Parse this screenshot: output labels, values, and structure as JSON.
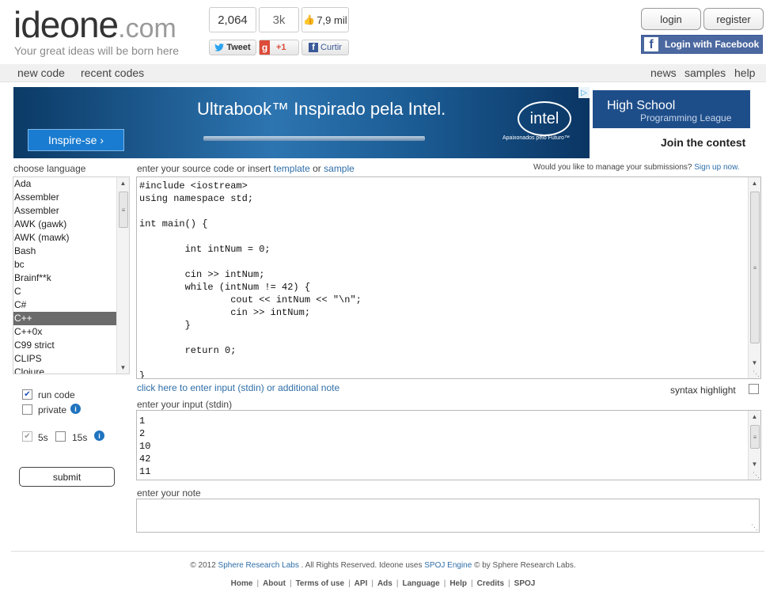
{
  "header": {
    "logo_main": "ideone",
    "logo_tld": ".com",
    "tagline": "Your great ideas will be born here",
    "tweet_count": "2,064",
    "gplus_count": "3k",
    "fb_count": "7,9 mil",
    "tweet_label": "Tweet",
    "gplus_label": "+1",
    "fb_like_label": "Curtir",
    "login_label": "login",
    "register_label": "register",
    "fb_login_label": "Login with Facebook"
  },
  "nav": {
    "left": [
      "new code",
      "recent codes"
    ],
    "right": [
      "news",
      "samples",
      "help"
    ]
  },
  "banner": {
    "headline": "Ultrabook™ Inspirado pela Intel.",
    "cta": "Inspire-se ›",
    "brand": "intel",
    "slogan": "Apaixonados pelo Futuro™"
  },
  "promo": {
    "line1": "High School",
    "line2": "Programming League",
    "contest": "Join the contest"
  },
  "language": {
    "label": "choose language",
    "items": [
      "Ada",
      "Assembler",
      "Assembler",
      "AWK (gawk)",
      "AWK (mawk)",
      "Bash",
      "bc",
      "Brainf**k",
      "C",
      "C#",
      "C++",
      "C++0x",
      "C99 strict",
      "CLIPS",
      "Clojure"
    ],
    "selected": "C++"
  },
  "source": {
    "label_prefix": "enter your source code or insert ",
    "template_link": "template",
    "label_or": " or ",
    "sample_link": "sample",
    "manage_text": "Would you like to manage your submissions?",
    "signup_link": "Sign up now.",
    "code": "#include <iostream>\nusing namespace std;\n\nint main() {\n\n        int intNum = 0;\n\n        cin >> intNum;\n        while (intNum != 42) {\n                cout << intNum << \"\\n\";\n                cin >> intNum;\n        }\n\n        return 0;\n\n}"
  },
  "stdin": {
    "toggle_link": "click here to enter input (stdin) or additional note",
    "syntax_label": "syntax highlight",
    "label": "enter your input (stdin)",
    "value": "1\n2\n10\n42\n11"
  },
  "note": {
    "label": "enter your note",
    "value": ""
  },
  "options": {
    "run_code": "run code",
    "private": "private",
    "time_5": "5s",
    "time_15": "15s",
    "submit": "submit"
  },
  "footer": {
    "copyright_prefix": "© 2012 ",
    "company_link": "Sphere Research Labs",
    "copyright_mid": " . All Rights Reserved. Ideone uses ",
    "engine_link": "SPOJ Engine",
    "copyright_suffix": " © by Sphere Research Labs.",
    "links": [
      "Home",
      "About",
      "Terms of use",
      "API",
      "Ads",
      "Language",
      "Help",
      "Credits",
      "SPOJ"
    ]
  },
  "colors": {
    "accent_link": "#2f6ea8",
    "facebook": "#4c68a0",
    "selected_language": "#6b6b6b"
  }
}
